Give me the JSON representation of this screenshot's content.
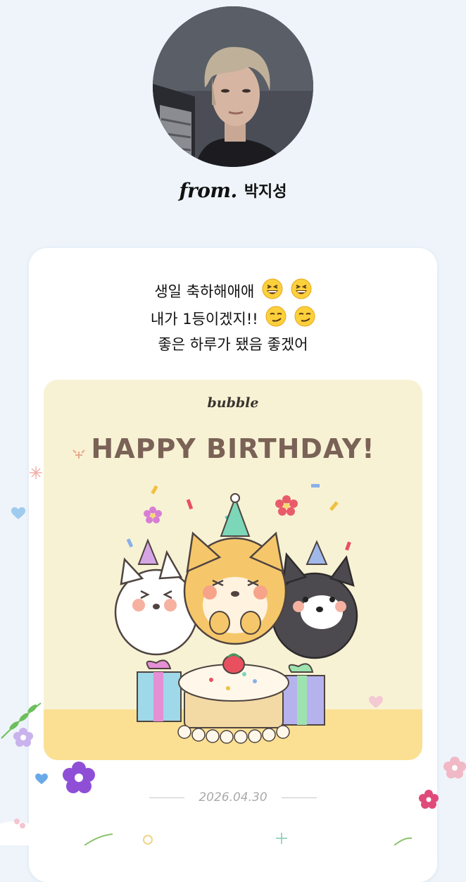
{
  "sender": {
    "from_label": "from.",
    "name": "박지성"
  },
  "message": {
    "lines": [
      "생일 축하해애애",
      "내가 1등이겠지!!",
      "좋은 하루가 됐음 좋겠어"
    ],
    "emojis": [
      "grinning-squinting-face",
      "smirking-face"
    ]
  },
  "birthday_card": {
    "brand": "bubble",
    "title": "HAPPY BIRTHDAY!"
  },
  "date": "2026.04.30",
  "colors": {
    "background": "#eef4fa",
    "card_background": "#f8f2d5",
    "title_color": "#7a6256"
  }
}
